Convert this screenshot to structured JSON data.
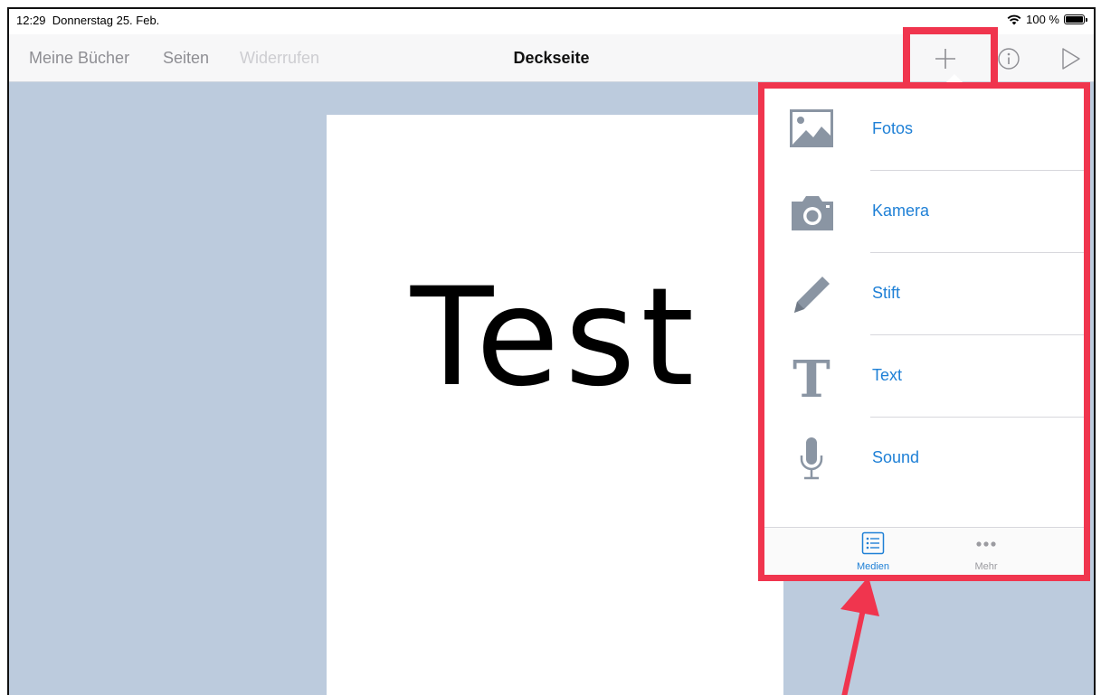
{
  "status": {
    "time": "12:29",
    "date": "Donnerstag 25. Feb.",
    "battery": "100 %",
    "icons": [
      "wifi-icon",
      "battery-icon"
    ]
  },
  "navbar": {
    "my_books": "Meine Bücher",
    "pages": "Seiten",
    "undo": "Widerrufen",
    "title": "Deckseite",
    "icons": [
      "plus-icon",
      "info-icon",
      "play-icon"
    ]
  },
  "page": {
    "text": "Test"
  },
  "popover": {
    "items": [
      {
        "label": "Fotos",
        "icon": "photo-icon"
      },
      {
        "label": "Kamera",
        "icon": "camera-icon"
      },
      {
        "label": "Stift",
        "icon": "pencil-icon"
      },
      {
        "label": "Text",
        "icon": "text-icon"
      },
      {
        "label": "Sound",
        "icon": "microphone-icon"
      }
    ],
    "tabs": [
      {
        "label": "Medien",
        "icon": "list-icon",
        "selected": true
      },
      {
        "label": "Mehr",
        "icon": "more-icon",
        "selected": false
      }
    ]
  },
  "colors": {
    "accent": "#1f80d6",
    "highlight": "#f0354e",
    "background": "#bccbdd",
    "icon_gray": "#8a95a3"
  }
}
